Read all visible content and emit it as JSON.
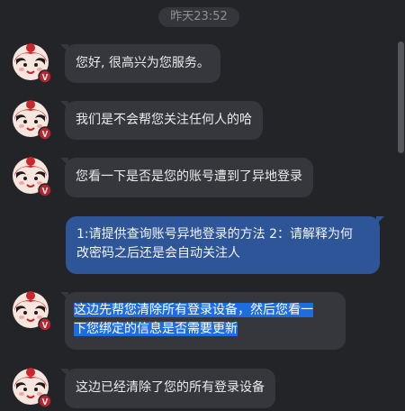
{
  "timestamp": "昨天23:52",
  "messages": [
    {
      "text": "您好, 很高兴为您服务。"
    },
    {
      "text": "我们是不会帮您关注任何人的哈"
    },
    {
      "text": "您看一下是否是您的账号遭到了异地登录"
    },
    {
      "line1": "1:请提供查询账号异地登录的方法 2：请解释为何",
      "line2": "改密码之后还是会自动关注人"
    },
    {
      "line1": "这边先帮您清除所有登录设备，然后您看一",
      "line2": "下您绑定的信息是否需要更新"
    },
    {
      "text": "这边已经清除了您的所有登录设备"
    }
  ],
  "avatar_badge": "V",
  "colors": {
    "background": "#232428",
    "incoming_bubble": "#36373c",
    "outgoing_bubble": "#2e5597",
    "selection": "#1d6ce0",
    "avatar_badge": "#b8252f"
  }
}
